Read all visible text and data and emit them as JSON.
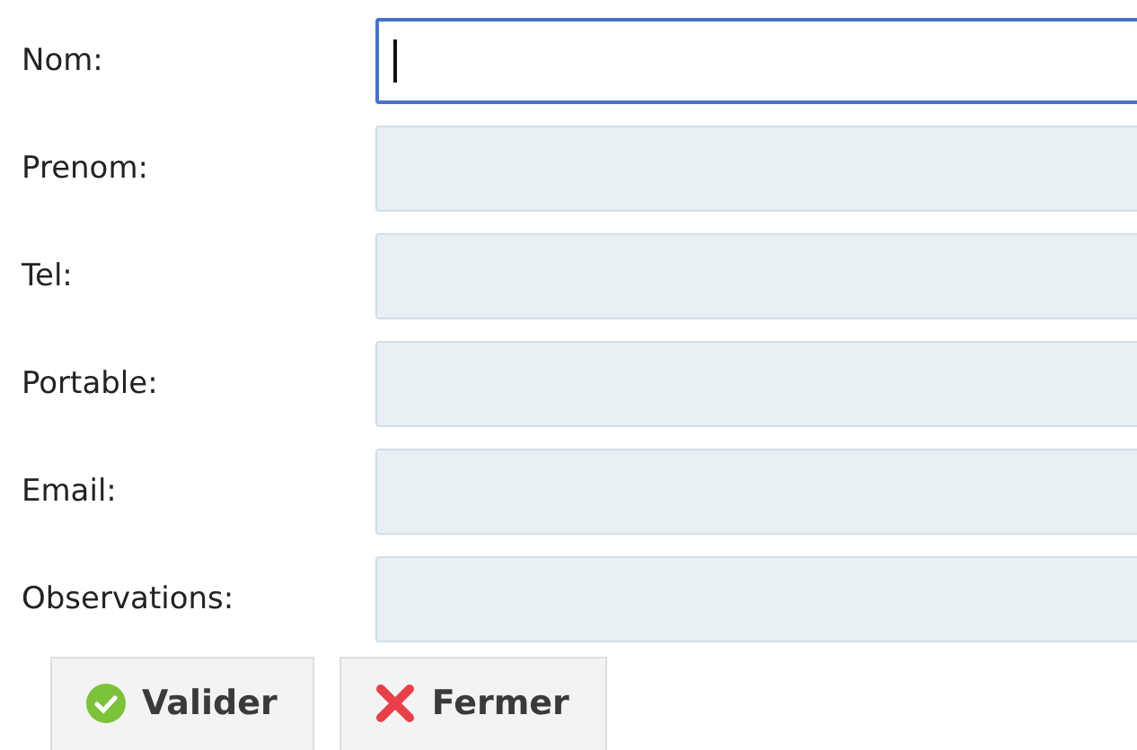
{
  "fields": [
    {
      "label": "Nom:",
      "focused": true
    },
    {
      "label": "Prenom:",
      "focused": false
    },
    {
      "label": "Tel:",
      "focused": false
    },
    {
      "label": "Portable:",
      "focused": false
    },
    {
      "label": "Email:",
      "focused": false
    },
    {
      "label": "Observations:",
      "focused": false
    }
  ],
  "buttons": [
    {
      "label": "Valider",
      "kind": "confirm"
    },
    {
      "label": "Fermer",
      "kind": "close"
    }
  ]
}
